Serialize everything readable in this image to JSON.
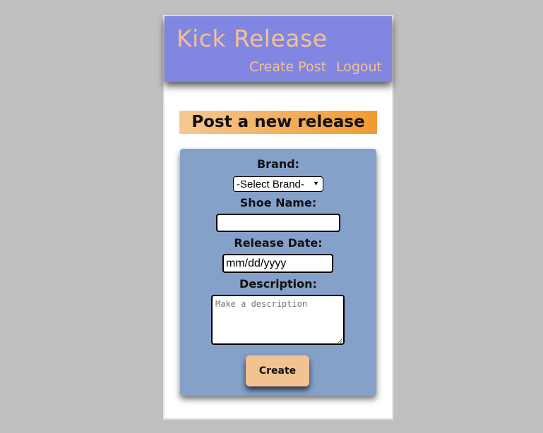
{
  "header": {
    "site_title": "Kick Release",
    "nav": {
      "create_post": "Create Post",
      "logout": "Logout"
    }
  },
  "main": {
    "heading": "Post a new release",
    "form": {
      "brand_label": "Brand:",
      "brand_selected": "-Select Brand-",
      "shoe_name_label": "Shoe Name:",
      "shoe_name_value": "",
      "release_date_label": "Release Date:",
      "release_date_value": "mm/dd/yyyy",
      "description_label": "Description:",
      "description_placeholder": "Make a description",
      "create_button": "Create"
    }
  },
  "colors": {
    "page_background": "#c0c0c0",
    "header_background": "#8186e3",
    "header_text": "#f3c291",
    "heading_gradient_start": "#f5c892",
    "heading_gradient_end": "#f29a32",
    "form_background": "#85a0c9",
    "button_background": "#f3c291"
  },
  "icons": {
    "select_arrow": "dropdown-arrow-icon"
  }
}
